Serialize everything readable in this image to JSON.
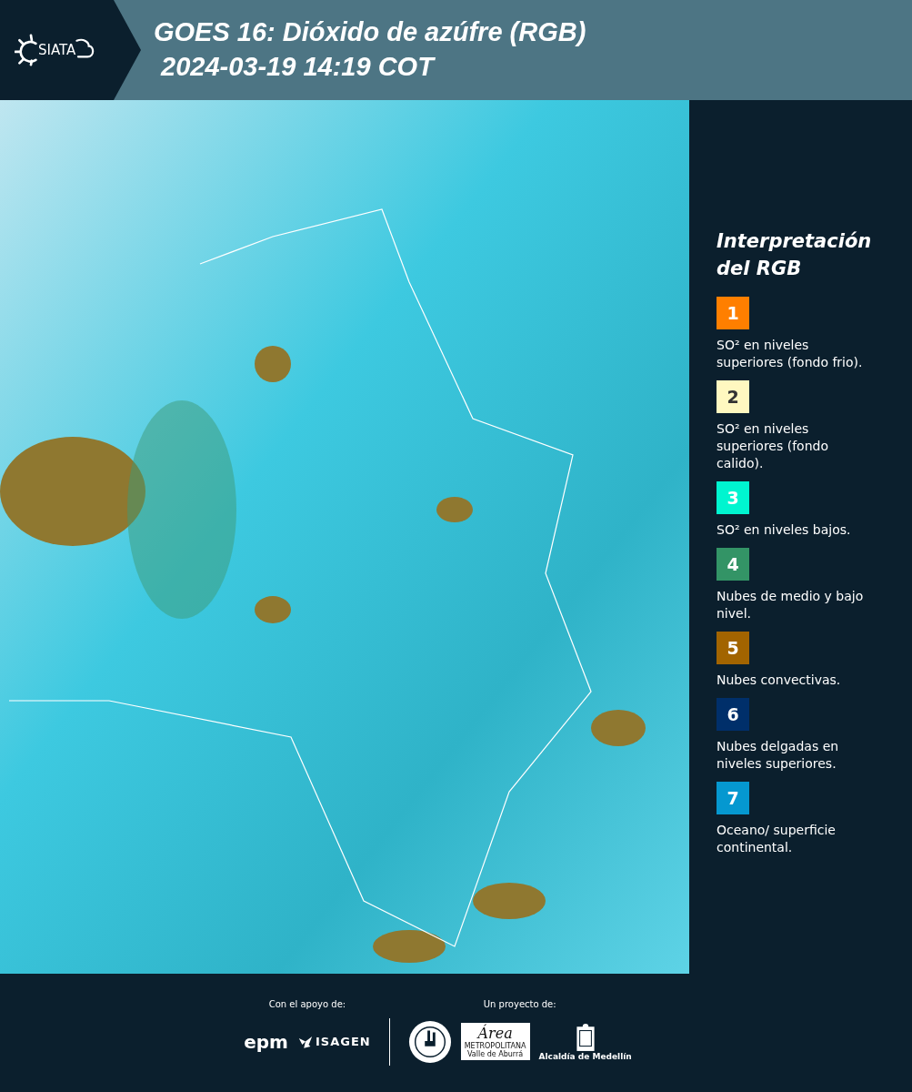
{
  "header": {
    "logo": "SIATA",
    "title": "GOES 16: Dióxido de azúfre (RGB)",
    "subtitle": "2024-03-19 14:19 COT"
  },
  "legend": {
    "title": "Interpretación del RGB",
    "items": [
      {
        "number": "1",
        "color": "#ff7f00",
        "text": "SO² en niveles superiores (fondo frio)."
      },
      {
        "number": "2",
        "color": "#fff8c0",
        "text": "SO² en niveles superiores (fondo calido)."
      },
      {
        "number": "3",
        "color": "#00f5d0",
        "text": "SO² en niveles bajos."
      },
      {
        "number": "4",
        "color": "#339466",
        "text": "Nubes de medio y bajo nivel."
      },
      {
        "number": "5",
        "color": "#a26400",
        "text": "Nubes convectivas."
      },
      {
        "number": "6",
        "color": "#002f6a",
        "text": "Nubes delgadas en niveles superiores."
      },
      {
        "number": "7",
        "color": "#0598d0",
        "text": "Oceano/ superficie continental."
      }
    ]
  },
  "footer": {
    "support_label": "Con el apoyo de:",
    "support_logos": [
      "epm",
      "ISAGEN"
    ],
    "project_label": "Un proyecto de:",
    "area_logo": {
      "name": "Área",
      "line1": "METROPOLITANA",
      "line2": "Valle de Aburrá"
    },
    "city_logo": "Alcaldía de Medellín"
  }
}
